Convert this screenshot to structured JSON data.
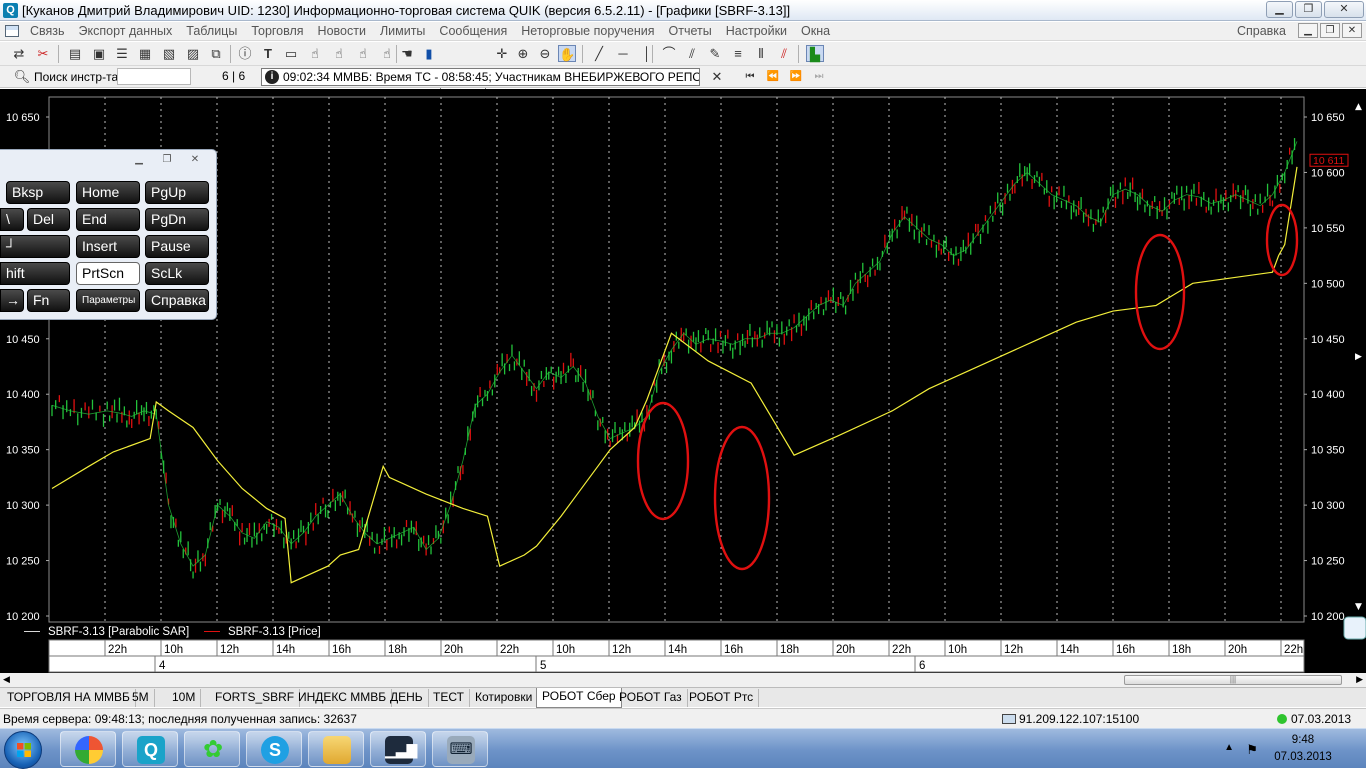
{
  "window": {
    "title": "[Куканов Дмитрий Владимирович  UID: 1230] Информационно-торговая система QUIK (версия 6.5.2.11) - [Графики [SBRF-3.13]]",
    "app_icon": "Q"
  },
  "menu": {
    "items": [
      "Связь",
      "Экспорт данных",
      "Таблицы",
      "Торговля",
      "Новости",
      "Лимиты",
      "Сообщения",
      "Неторговые поручения",
      "Отчеты",
      "Настройки",
      "Окна"
    ],
    "help": "Справка"
  },
  "toolbar": {
    "timeframe": "M5"
  },
  "toolbar2": {
    "search_label": "Поиск инстр-та",
    "search_value": "",
    "page_count": "6 | 6",
    "news": "09:02:34  ММВБ: Время ТС - 08:58:45; Участникам ВНЕБИРЖЕВОГО РЕПО! Се"
  },
  "keyboard": {
    "keys": [
      [
        "Bksp",
        "Home",
        "PgUp"
      ],
      [
        "\\",
        "Del",
        "End",
        "PgDn"
      ],
      [
        "┘",
        "Insert",
        "Pause"
      ],
      [
        "hift",
        "PrtScn",
        "ScLk"
      ],
      [
        "→",
        "Fn",
        "Параметры",
        "Справка"
      ]
    ]
  },
  "chart_data": {
    "type": "line",
    "instrument": "SBRF-3.13",
    "y_ticks": [
      "10 650",
      "10 600",
      "10 550",
      "10 500",
      "10 450",
      "10 400",
      "10 350",
      "10 300",
      "10 250",
      "10 200"
    ],
    "ylim": [
      10200,
      10650
    ],
    "current_price_label": "10 611",
    "x_time_labels": [
      "22h",
      "10h",
      "12h",
      "14h",
      "16h",
      "18h",
      "20h",
      "22h",
      "10h",
      "12h",
      "14h",
      "16h",
      "18h",
      "20h",
      "22h",
      "10h",
      "12h",
      "14h",
      "16h",
      "18h",
      "20h",
      "22h"
    ],
    "x_day_labels": [
      "4",
      "5",
      "6"
    ],
    "legend": [
      "SBRF-3.13 [Parabolic SAR]",
      "SBRF-3.13 [Price]"
    ],
    "series": [
      {
        "name": "SBRF-3.13 [Price]",
        "color": "#23c23b",
        "x_hours": [
          0,
          3,
          6,
          9,
          11,
          13,
          15,
          17,
          19,
          21,
          23,
          25,
          27,
          29,
          31,
          33,
          35,
          37,
          39,
          41,
          43,
          45,
          47,
          49,
          51,
          53,
          55,
          57,
          59,
          61,
          63,
          65,
          67,
          69,
          71,
          73,
          75,
          77,
          79,
          81,
          83,
          85,
          87,
          89,
          91,
          93,
          95,
          97,
          99,
          101,
          103,
          105,
          107,
          109,
          111,
          113,
          115,
          117,
          119,
          121,
          123,
          125,
          127,
          129,
          131,
          133,
          135,
          137,
          139,
          141,
          143,
          145,
          147,
          149,
          151,
          153,
          155,
          157,
          159,
          161,
          163,
          165,
          167,
          169,
          171,
          173,
          175,
          177,
          179,
          181,
          183,
          185,
          187,
          189,
          191,
          193,
          195,
          197,
          199,
          201,
          203
        ],
        "values": [
          10390,
          10385,
          10382,
          10385,
          10383,
          10380,
          10385,
          10382,
          10300,
          10265,
          10245,
          10255,
          10300,
          10290,
          10275,
          10270,
          10285,
          10280,
          10265,
          10275,
          10290,
          10300,
          10310,
          10290,
          10275,
          10265,
          10270,
          10275,
          10280,
          10260,
          10270,
          10300,
          10340,
          10390,
          10400,
          10420,
          10435,
          10420,
          10405,
          10420,
          10415,
          10425,
          10410,
          10380,
          10360,
          10365,
          10370,
          10380,
          10420,
          10440,
          10455,
          10445,
          10450,
          10448,
          10445,
          10450,
          10450,
          10455,
          10455,
          10460,
          10470,
          10480,
          10485,
          10480,
          10500,
          10510,
          10520,
          10545,
          10560,
          10550,
          10540,
          10535,
          10525,
          10530,
          10545,
          10560,
          10575,
          10590,
          10600,
          10590,
          10580,
          10575,
          10570,
          10560,
          10555,
          10580,
          10585,
          10580,
          10570,
          10565,
          10575,
          10580,
          10578,
          10572,
          10575,
          10580,
          10575,
          10570,
          10580,
          10600,
          10628
        ]
      },
      {
        "name": "SBRF-3.13 [Parabolic SAR]",
        "color": "#f2ee3a",
        "x_hours": [
          0,
          6,
          10,
          16,
          17,
          19,
          23,
          27,
          31,
          35,
          38,
          39,
          45,
          47,
          50,
          54,
          55,
          57,
          61,
          67,
          71,
          73,
          75,
          77,
          79,
          83,
          85,
          89,
          91,
          95,
          97,
          101,
          107,
          114,
          121,
          128,
          137,
          143,
          149,
          155,
          161,
          167,
          173,
          180,
          183,
          186,
          199,
          200,
          201,
          203
        ],
        "values": [
          10315,
          10335,
          10348,
          10360,
          10393,
          10385,
          10370,
          10340,
          10315,
          10297,
          10288,
          10230,
          10245,
          10255,
          10260,
          10335,
          10325,
          10320,
          10310,
          10297,
          10290,
          10245,
          10250,
          10255,
          10263,
          10290,
          10305,
          10335,
          10350,
          10370,
          10395,
          10455,
          10430,
          10410,
          10345,
          10362,
          10385,
          10405,
          10420,
          10435,
          10450,
          10465,
          10475,
          10480,
          10490,
          10500,
          10510,
          10525,
          10535,
          10605
        ]
      }
    ]
  },
  "tabs": {
    "items": [
      "ТОРГОВЛЯ НА ММВБ",
      "5М",
      "10М",
      "FORTS_SBRF",
      "ИНДЕКС ММВБ",
      "ДЕНЬ",
      "ТЕСТ",
      "Котировки",
      "РОБОТ Сбер",
      "РОБОТ Газ",
      "РОБОТ Ртс"
    ],
    "active": "РОБОТ Сбер"
  },
  "status": {
    "left": "Время сервера: 09:48:13; последняя полученная запись: 32637",
    "server": "91.209.122.107:15100",
    "date": "07.03.2013"
  },
  "taskbar": {
    "time": "9:48",
    "date": "07.03.2013"
  },
  "colors": {
    "price": "#23c23b",
    "sar": "#f2ee3a",
    "annotation": "#e01010",
    "current_price": "#e01010"
  }
}
